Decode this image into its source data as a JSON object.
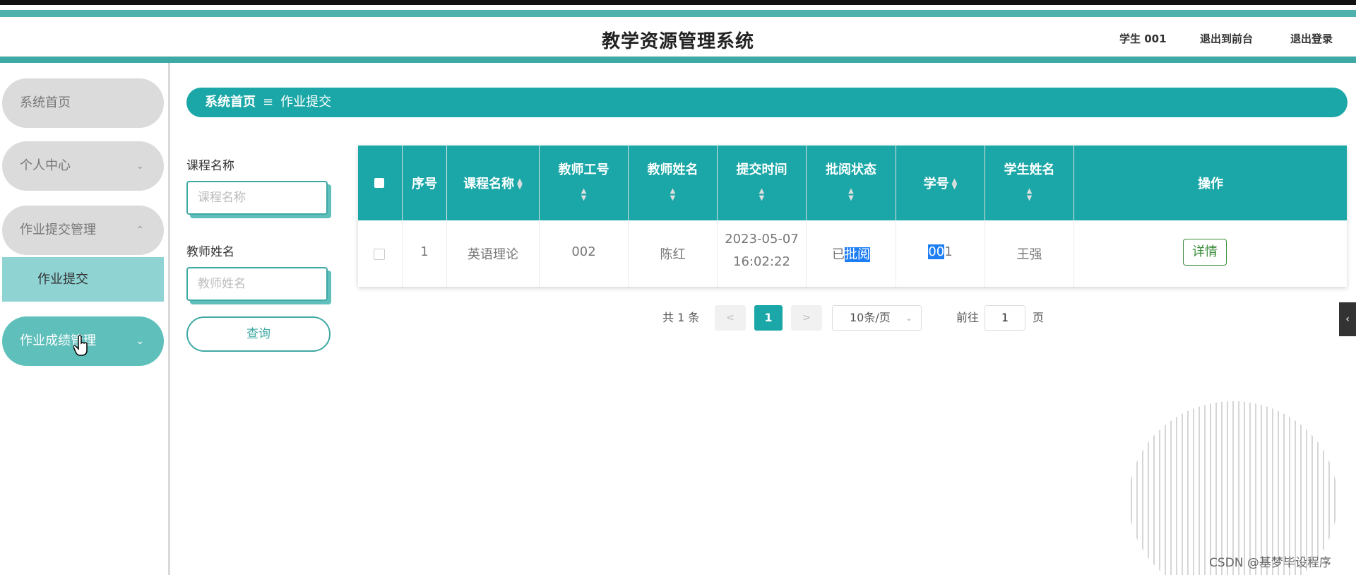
{
  "app": {
    "title": "教学资源管理系统",
    "user_label": "学生 001",
    "front_link": "退出到前台",
    "logout_link": "退出登录"
  },
  "colors": {
    "primary": "#1ba7a7",
    "sidebar_active": "#5fbfbb",
    "submenu_active": "#8fd3d3",
    "menu_inactive": "#dcdbdc"
  },
  "sidebar": {
    "items": [
      {
        "label": "系统首页"
      },
      {
        "label": "个人中心",
        "icon": "chevron-down"
      },
      {
        "label": "作业提交管理",
        "icon": "chevron-up"
      },
      {
        "label": "作业成绩管理",
        "icon": "chevron-down"
      }
    ],
    "submenu": {
      "label": "作业提交"
    }
  },
  "breadcrumb": {
    "home": "系统首页",
    "separator_icon": "menu-icon",
    "current": "作业提交"
  },
  "search": {
    "course_label": "课程名称",
    "course_placeholder": "课程名称",
    "teacher_label": "教师姓名",
    "teacher_placeholder": "教师姓名",
    "query_button": "查询"
  },
  "table": {
    "columns": [
      "序号",
      "课程名称",
      "教师工号",
      "教师姓名",
      "提交时间",
      "批阅状态",
      "学号",
      "学生姓名",
      "操作"
    ],
    "rows": [
      {
        "index": "1",
        "course": "英语理论",
        "teacher_id": "002",
        "teacher_name": "陈红",
        "submit_date": "2023-05-07",
        "submit_time": "16:02:22",
        "status_prefix": "已",
        "status_highlight": "批阅",
        "student_id_highlight": "00",
        "student_id_rest": "1",
        "student_name": "王强",
        "action": "详情"
      }
    ]
  },
  "pagination": {
    "total_text": "共 1 条",
    "prev": "<",
    "current_page": "1",
    "next": ">",
    "page_size": "10条/页",
    "goto_label": "前往",
    "goto_value": "1",
    "page_suffix": "页"
  },
  "watermark": "CSDN @基梦毕设程序"
}
